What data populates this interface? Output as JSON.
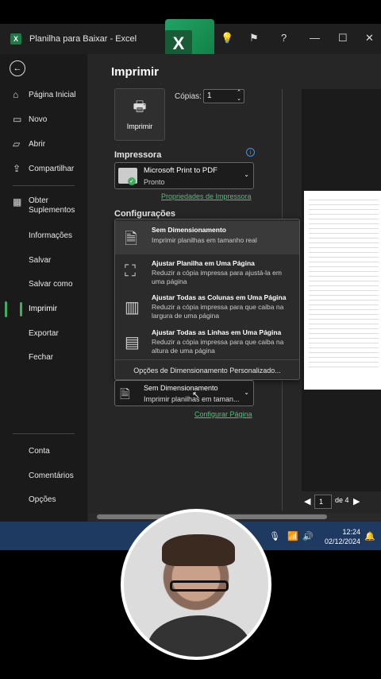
{
  "titlebar": {
    "logo_letter": "X",
    "title": "Planilha para Baixar - Excel"
  },
  "excel_logo": {
    "letter": "X"
  },
  "sidebar": {
    "back": "←",
    "items": [
      {
        "label": "Página Inicial",
        "icon": "⌂"
      },
      {
        "label": "Novo",
        "icon": "▭"
      },
      {
        "label": "Abrir",
        "icon": "▱"
      },
      {
        "label": "Compartilhar",
        "icon": "⇪"
      },
      {
        "label": "Obter Suplementos",
        "icon": "▦"
      },
      {
        "label": "Informações"
      },
      {
        "label": "Salvar"
      },
      {
        "label": "Salvar como"
      },
      {
        "label": "Imprimir"
      },
      {
        "label": "Exportar"
      },
      {
        "label": "Fechar"
      },
      {
        "label": "Conta"
      },
      {
        "label": "Comentários"
      },
      {
        "label": "Opções"
      }
    ]
  },
  "print": {
    "heading": "Imprimir",
    "button_label": "Imprimir",
    "copies_label": "Cópias:",
    "copies_value": "1",
    "printer_section": "Impressora",
    "printer_name": "Microsoft Print to PDF",
    "printer_status": "Pronto",
    "printer_properties": "Propriedades de Impressora",
    "settings_section": "Configurações",
    "configure_page": "Configurar Página"
  },
  "scaling_menu": {
    "options": [
      {
        "title": "Sem Dimensionamento",
        "desc": "Imprimir planilhas em tamanho real"
      },
      {
        "title": "Ajustar Planilha em Uma Página",
        "desc": "Reduzir a cópia impressa para ajustá-la em uma página"
      },
      {
        "title": "Ajustar Todas as Colunas em Uma Página",
        "desc": "Reduzir a cópia impressa para que caiba na largura de uma página"
      },
      {
        "title": "Ajustar Todas as Linhas em Uma Página",
        "desc": "Reduzir a cópia impressa para que caiba na altura de uma página"
      }
    ],
    "custom": "Opções de Dimensionamento Personalizado..."
  },
  "scaling_select": {
    "title": "Sem Dimensionamento",
    "desc": "Imprimir planilhas em taman..."
  },
  "pager": {
    "current": "1",
    "total_label": "de 4"
  },
  "taskbar": {
    "time": "12:24",
    "date": "02/12/2024"
  },
  "colors": {
    "accent": "#3fae5f",
    "link": "#4dc174",
    "taskbar": "#1e3a60"
  }
}
